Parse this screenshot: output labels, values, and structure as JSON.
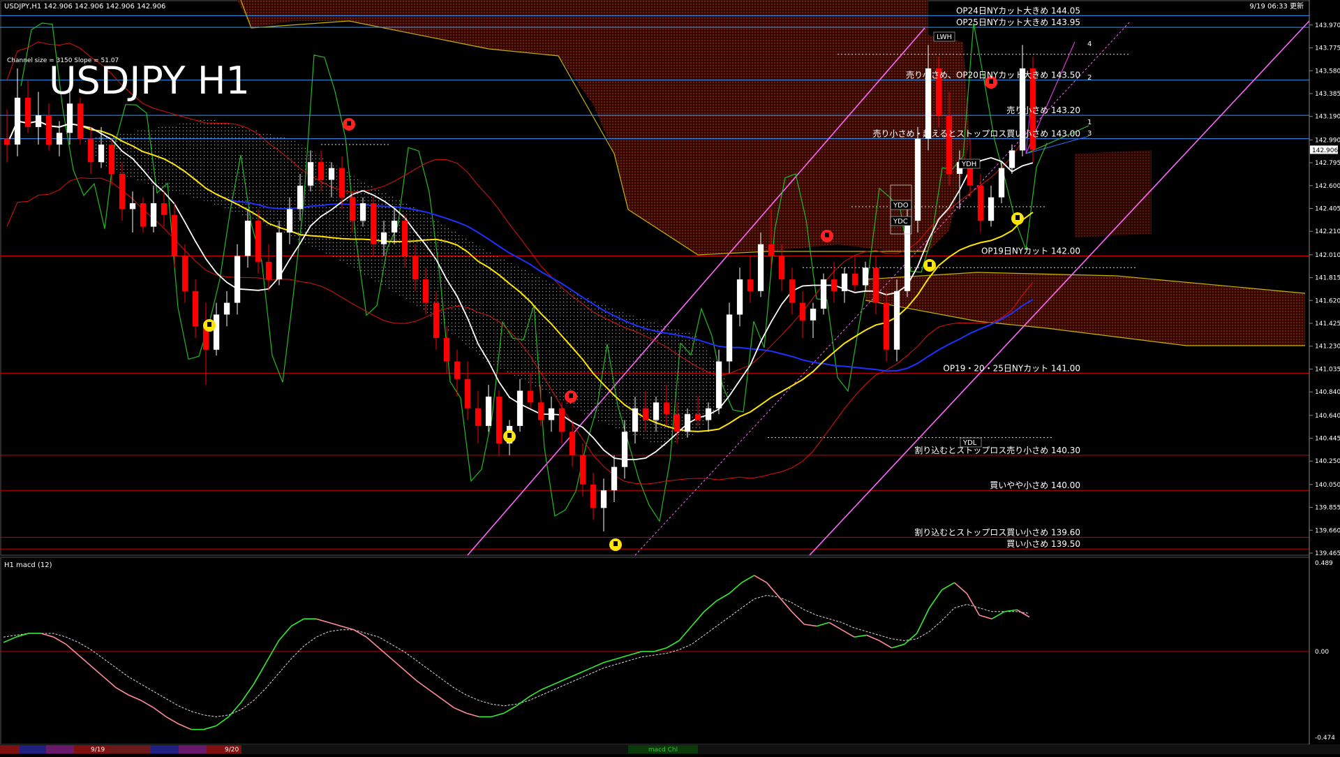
{
  "header": {
    "symbol_info": "USDJPY,H1  142.906 142.906 142.906 142.906",
    "datetime": "9/19 06:33 更新",
    "channel_info": "Channel size = 3150 Slope = 51.07",
    "big_title": "USDJPY H1",
    "macd_label": "H1  macd (12)"
  },
  "colors": {
    "background": "#000000",
    "bull_candle": "#ffffff",
    "bear_candle": "#ff0000",
    "ma_white": "#ffffff",
    "ma_yellow": "#ffe600",
    "ma_blue": "#1e32ff",
    "chikou_green": "#22bb22",
    "bollinger_red": "#dd1111",
    "channel_pink": "#ff66ff",
    "cloud_red": "#8b1a0a",
    "cloud_white": "#bbbbbb",
    "hline_red": "#cc0000",
    "hline_blue": "#3399ff",
    "macd_up": "#33ee33",
    "macd_down": "#ff8a9a"
  },
  "chart_data": {
    "type": "candlestick",
    "title": "USDJPY H1",
    "ylim": [
      139.465,
      144.1
    ],
    "y_ticks": [
      "143.970",
      "143.775",
      "143.580",
      "143.385",
      "143.190",
      "142.990",
      "142.795",
      "142.600",
      "142.405",
      "142.210",
      "142.010",
      "141.815",
      "141.620",
      "141.425",
      "141.230",
      "141.035",
      "140.840",
      "140.640",
      "140.445",
      "140.250",
      "140.050",
      "139.855",
      "139.660",
      "139.465"
    ],
    "current_price": "142.906",
    "x_labels": [
      "9/19",
      "9/20"
    ],
    "candles": [
      [
        143.0,
        143.25,
        142.8,
        142.95
      ],
      [
        142.95,
        143.6,
        142.85,
        143.35
      ],
      [
        143.35,
        143.5,
        143.05,
        143.1
      ],
      [
        143.1,
        143.4,
        142.95,
        143.2
      ],
      [
        143.2,
        143.3,
        142.9,
        142.95
      ],
      [
        142.95,
        143.15,
        142.85,
        143.05
      ],
      [
        143.05,
        143.4,
        142.95,
        143.3
      ],
      [
        143.3,
        143.35,
        142.95,
        143.0
      ],
      [
        143.0,
        143.1,
        142.7,
        142.8
      ],
      [
        142.8,
        143.1,
        142.75,
        142.95
      ],
      [
        142.95,
        143.0,
        142.6,
        142.7
      ],
      [
        142.7,
        142.8,
        142.3,
        142.4
      ],
      [
        142.4,
        142.55,
        142.2,
        142.45
      ],
      [
        142.45,
        142.5,
        142.2,
        142.25
      ],
      [
        142.25,
        142.6,
        142.2,
        142.45
      ],
      [
        142.45,
        142.55,
        142.25,
        142.35
      ],
      [
        142.35,
        142.45,
        141.9,
        142.0
      ],
      [
        142.0,
        142.1,
        141.6,
        141.7
      ],
      [
        141.7,
        141.8,
        141.3,
        141.4
      ],
      [
        141.4,
        141.6,
        140.9,
        141.2
      ],
      [
        141.2,
        141.6,
        141.15,
        141.5
      ],
      [
        141.5,
        141.7,
        141.4,
        141.6
      ],
      [
        141.6,
        142.1,
        141.5,
        142.0
      ],
      [
        142.0,
        142.4,
        141.9,
        142.3
      ],
      [
        142.3,
        142.4,
        141.85,
        141.95
      ],
      [
        141.95,
        142.1,
        141.7,
        141.8
      ],
      [
        141.8,
        142.3,
        141.75,
        142.2
      ],
      [
        142.2,
        142.5,
        142.1,
        142.4
      ],
      [
        142.4,
        142.7,
        142.3,
        142.6
      ],
      [
        142.6,
        142.9,
        142.55,
        142.8
      ],
      [
        142.8,
        142.9,
        142.55,
        142.65
      ],
      [
        142.65,
        142.8,
        142.5,
        142.75
      ],
      [
        142.75,
        142.85,
        142.4,
        142.5
      ],
      [
        142.5,
        142.55,
        142.2,
        142.3
      ],
      [
        142.3,
        142.5,
        142.25,
        142.45
      ],
      [
        142.45,
        142.5,
        142.0,
        142.1
      ],
      [
        142.1,
        142.3,
        142.0,
        142.2
      ],
      [
        142.2,
        142.4,
        142.1,
        142.3
      ],
      [
        142.3,
        142.35,
        141.9,
        142.0
      ],
      [
        142.0,
        142.1,
        141.7,
        141.8
      ],
      [
        141.8,
        141.9,
        141.5,
        141.6
      ],
      [
        141.6,
        141.7,
        141.2,
        141.3
      ],
      [
        141.3,
        141.4,
        141.0,
        141.1
      ],
      [
        141.1,
        141.2,
        140.8,
        140.95
      ],
      [
        140.95,
        141.1,
        140.6,
        140.7
      ],
      [
        140.7,
        140.85,
        140.4,
        140.55
      ],
      [
        140.55,
        140.9,
        140.5,
        140.8
      ],
      [
        140.8,
        140.85,
        140.3,
        140.4
      ],
      [
        140.4,
        140.6,
        140.3,
        140.55
      ],
      [
        140.55,
        140.95,
        140.5,
        140.85
      ],
      [
        140.85,
        141.0,
        140.7,
        140.75
      ],
      [
        140.75,
        140.9,
        140.55,
        140.6
      ],
      [
        140.6,
        140.8,
        140.5,
        140.7
      ],
      [
        140.7,
        140.75,
        140.4,
        140.5
      ],
      [
        140.5,
        140.6,
        140.2,
        140.3
      ],
      [
        140.3,
        140.4,
        139.95,
        140.05
      ],
      [
        140.05,
        140.15,
        139.75,
        139.85
      ],
      [
        139.85,
        140.1,
        139.65,
        140.0
      ],
      [
        140.0,
        140.3,
        139.9,
        140.2
      ],
      [
        140.2,
        140.6,
        140.1,
        140.5
      ],
      [
        140.5,
        140.8,
        140.4,
        140.7
      ],
      [
        140.7,
        140.85,
        140.5,
        140.6
      ],
      [
        140.6,
        140.8,
        140.5,
        140.75
      ],
      [
        140.75,
        140.9,
        140.55,
        140.65
      ],
      [
        140.65,
        140.75,
        140.4,
        140.5
      ],
      [
        140.5,
        140.7,
        140.45,
        140.65
      ],
      [
        140.65,
        140.8,
        140.55,
        140.6
      ],
      [
        140.6,
        140.75,
        140.5,
        140.7
      ],
      [
        140.7,
        141.2,
        140.65,
        141.1
      ],
      [
        141.1,
        141.6,
        141.0,
        141.5
      ],
      [
        141.5,
        141.9,
        141.4,
        141.8
      ],
      [
        141.8,
        142.0,
        141.6,
        141.7
      ],
      [
        141.7,
        142.2,
        141.65,
        142.1
      ],
      [
        142.1,
        142.4,
        141.9,
        142.0
      ],
      [
        142.0,
        142.1,
        141.7,
        141.8
      ],
      [
        141.8,
        141.9,
        141.5,
        141.6
      ],
      [
        141.6,
        141.7,
        141.3,
        141.45
      ],
      [
        141.45,
        141.6,
        141.3,
        141.55
      ],
      [
        141.55,
        141.85,
        141.5,
        141.8
      ],
      [
        141.8,
        141.95,
        141.6,
        141.7
      ],
      [
        141.7,
        141.9,
        141.6,
        141.85
      ],
      [
        141.85,
        142.0,
        141.7,
        141.75
      ],
      [
        141.75,
        141.95,
        141.7,
        141.9
      ],
      [
        141.9,
        142.0,
        141.5,
        141.6
      ],
      [
        141.6,
        141.7,
        141.1,
        141.2
      ],
      [
        141.2,
        141.8,
        141.1,
        141.7
      ],
      [
        141.7,
        142.4,
        141.65,
        142.3
      ],
      [
        142.3,
        143.1,
        142.2,
        143.0
      ],
      [
        143.0,
        143.8,
        142.9,
        143.6
      ],
      [
        143.6,
        143.7,
        143.1,
        143.2
      ],
      [
        143.2,
        143.4,
        142.6,
        142.7
      ],
      [
        142.7,
        142.9,
        142.4,
        142.8
      ],
      [
        142.8,
        143.0,
        142.5,
        142.6
      ],
      [
        142.6,
        142.7,
        142.2,
        142.3
      ],
      [
        142.3,
        142.6,
        142.25,
        142.5
      ],
      [
        142.5,
        142.8,
        142.45,
        142.75
      ],
      [
        142.75,
        142.95,
        142.7,
        142.9
      ],
      [
        142.9,
        143.8,
        142.85,
        143.6
      ],
      [
        143.6,
        143.7,
        142.8,
        142.906
      ]
    ],
    "horizontal_levels": [
      {
        "price": 144.05,
        "label": "OP24日NYカット大きめ 144.05",
        "color": "blue"
      },
      {
        "price": 143.95,
        "label": "OP25日NYカット大きめ 143.95",
        "color": "blue"
      },
      {
        "price": 143.5,
        "label": "売り小さめ、OP20日NYカット大きめ 143.50",
        "color": "blue"
      },
      {
        "price": 143.2,
        "label": "売り小さめ 143.20",
        "color": "blue"
      },
      {
        "price": 143.0,
        "label": "売り小さめ・超えるとストップロス買い小さめ 143.00",
        "color": "blue"
      },
      {
        "price": 142.0,
        "label": "OP19日NYカット 142.00",
        "color": "red"
      },
      {
        "price": 141.0,
        "label": "OP19・20・25日NYカット 141.00",
        "color": "red"
      },
      {
        "price": 140.3,
        "label": "割り込むとストップロス売り小さめ 140.30",
        "color": "red"
      },
      {
        "price": 140.0,
        "label": "買いやや小さめ 140.00",
        "color": "red"
      },
      {
        "price": 139.6,
        "label": "割り込むとストップロス買い小さめ 139.60",
        "color": "red"
      },
      {
        "price": 139.5,
        "label": "買い小さめ 139.50",
        "color": "red"
      }
    ],
    "level_tags": [
      "YDH",
      "YDO",
      "YDC",
      "YDL",
      "LWH"
    ],
    "fib_numbers": [
      "4",
      "2",
      "1",
      "3"
    ],
    "macd": {
      "label": "H1  macd (12)",
      "ylim": [
        -0.474,
        0.489
      ],
      "y_ticks": [
        "0.489",
        "0.00",
        "-0.474"
      ],
      "bottom_label": "macd Chl",
      "main": [
        0.05,
        0.08,
        0.1,
        0.1,
        0.08,
        0.04,
        -0.02,
        -0.08,
        -0.14,
        -0.2,
        -0.24,
        -0.27,
        -0.31,
        -0.36,
        -0.4,
        -0.43,
        -0.43,
        -0.41,
        -0.36,
        -0.28,
        -0.18,
        -0.06,
        0.06,
        0.14,
        0.18,
        0.18,
        0.16,
        0.14,
        0.12,
        0.08,
        0.02,
        -0.04,
        -0.1,
        -0.16,
        -0.21,
        -0.26,
        -0.31,
        -0.34,
        -0.36,
        -0.36,
        -0.34,
        -0.3,
        -0.25,
        -0.21,
        -0.18,
        -0.15,
        -0.12,
        -0.09,
        -0.06,
        -0.04,
        -0.02,
        0.0,
        0.0,
        0.02,
        0.06,
        0.14,
        0.22,
        0.28,
        0.32,
        0.38,
        0.42,
        0.38,
        0.3,
        0.22,
        0.15,
        0.14,
        0.16,
        0.12,
        0.08,
        0.09,
        0.06,
        0.02,
        0.04,
        0.1,
        0.24,
        0.34,
        0.38,
        0.32,
        0.2,
        0.18,
        0.22,
        0.23,
        0.19
      ],
      "signal": [
        0.08,
        0.09,
        0.1,
        0.1,
        0.1,
        0.08,
        0.05,
        0.01,
        -0.04,
        -0.09,
        -0.14,
        -0.18,
        -0.22,
        -0.26,
        -0.3,
        -0.33,
        -0.35,
        -0.36,
        -0.35,
        -0.32,
        -0.27,
        -0.2,
        -0.12,
        -0.04,
        0.03,
        0.08,
        0.11,
        0.12,
        0.12,
        0.1,
        0.08,
        0.04,
        0.0,
        -0.05,
        -0.1,
        -0.15,
        -0.2,
        -0.24,
        -0.27,
        -0.29,
        -0.3,
        -0.29,
        -0.27,
        -0.24,
        -0.21,
        -0.18,
        -0.15,
        -0.12,
        -0.09,
        -0.07,
        -0.05,
        -0.03,
        -0.02,
        -0.01,
        0.01,
        0.04,
        0.09,
        0.14,
        0.19,
        0.24,
        0.29,
        0.31,
        0.3,
        0.27,
        0.23,
        0.2,
        0.18,
        0.16,
        0.13,
        0.11,
        0.09,
        0.07,
        0.06,
        0.07,
        0.11,
        0.17,
        0.24,
        0.26,
        0.24,
        0.22,
        0.22,
        0.22,
        0.21
      ]
    }
  },
  "taskbar": {
    "labels": [
      "9/19",
      "9/20"
    ]
  }
}
